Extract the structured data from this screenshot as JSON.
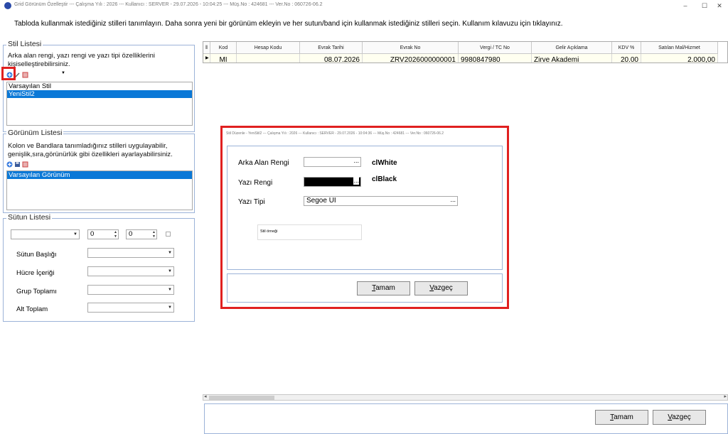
{
  "window": {
    "title": "Grid Görünüm Özelleştir  ---  Çalışma Yılı : 2026  ---  Kullanıcı : SERVER - 29.07.2026 - 10:04:25  ---  Müş.No : 424681  ---  Ver.No : 060726-06.2",
    "minimize": "–",
    "maximize": "☐",
    "close": "✕"
  },
  "instruction": "Tabloda kullanmak istediğiniz stilleri tanımlayın. Daha sonra  yeni bir görünüm ekleyin ve her sutun/band için kullanmak istediğiniz stilleri seçin. Kullanım kılavuzu için tıklayınız.",
  "style_list": {
    "title": "Stil Listesi",
    "description": "Arka alan rengi, yazı rengi ve yazı tipi özelliklerini kişiselleştirebilirsiniz.",
    "items": [
      {
        "label": "Varsayılan Stil"
      },
      {
        "label": "YeniStil2"
      }
    ]
  },
  "view_list": {
    "title": "Görünüm Listesi",
    "description": "Kolon ve Bandlara tanımladığınız stilleri uygulayabilir, genişlik,sıra,görünürlük gibi özellikleri ayarlayabilirsiniz.",
    "items": [
      {
        "label": "Varsayılan Görünüm"
      }
    ]
  },
  "column_list": {
    "title": "Sütun Listesi",
    "spin1": "0",
    "spin2": "0",
    "header_label": "Sütun Başlığı",
    "cell_label": "Hücre İçeriği",
    "group_total_label": "Grup Toplamı",
    "subtotal_label": "Alt Toplam"
  },
  "grid": {
    "headers": [
      "Kod",
      "Hesap Kodu",
      "Evrak Tarihi",
      "Evrak No",
      "Vergi / TC No",
      "Gelir Açıklama",
      "KDV %",
      "Satılan Mal/Hizmet"
    ],
    "row": [
      "MI",
      "",
      "08.07.2026",
      "ZRV2026000000001",
      "9980847980",
      "Zirve Akademi",
      "20.00",
      "2.000,00"
    ]
  },
  "buttons": {
    "ok_accel": "T",
    "ok_rest": "amam",
    "cancel_accel": "V",
    "cancel_rest": "azgeç"
  },
  "dialog": {
    "title": "Stil Düzenle - YeniStil2  ---  Çalışma Yılı : 2026  ---  Kullanıcı : SERVER - 29.07.2026 - 10:04:36  ---  Müş.No : 424681  ---  Ver.No : 060726-06.2",
    "bg_label": "Arka Alan Rengi",
    "bg_value": "clWhite",
    "text_color_label": "Yazı Rengi",
    "text_color_value": "clBlack",
    "font_label": "Yazı Tipi",
    "font_value": "Segoe UI",
    "ellipsis": "...",
    "preview_text": "Stil örneği"
  },
  "colors": {
    "highlight": "#e02020",
    "selection": "#0a78d7",
    "group_border": "#9cb3d8"
  }
}
